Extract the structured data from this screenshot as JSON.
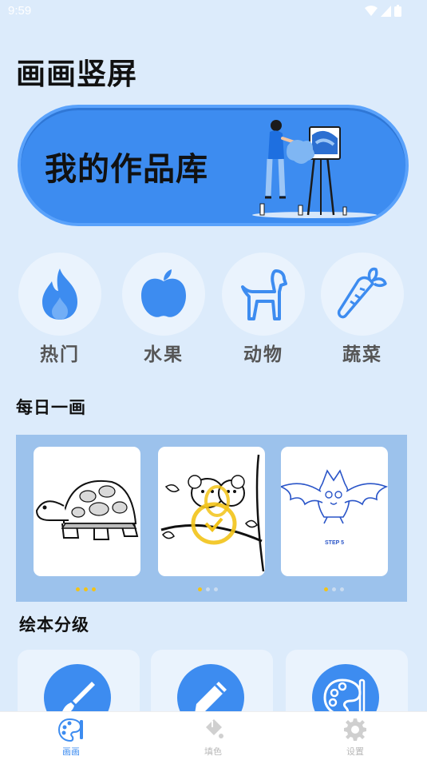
{
  "status": {
    "time": "9:59"
  },
  "app": {
    "title": "画画竖屏"
  },
  "banner": {
    "text": "我的作品库"
  },
  "categories": [
    {
      "label": "热门",
      "icon": "flame-icon"
    },
    {
      "label": "水果",
      "icon": "apple-icon"
    },
    {
      "label": "动物",
      "icon": "dog-icon"
    },
    {
      "label": "蔬菜",
      "icon": "carrot-icon"
    }
  ],
  "daily": {
    "title": "每日一画",
    "cards": [
      {
        "subject": "turtle drawing"
      },
      {
        "subject": "mice on branch drawing"
      },
      {
        "subject": "bat drawing",
        "caption": "STEP 5"
      }
    ]
  },
  "levels": {
    "title": "绘本分级",
    "items": [
      {
        "icon": "brush-icon"
      },
      {
        "icon": "pencil-icon"
      },
      {
        "icon": "palette-icon"
      }
    ]
  },
  "tabs": [
    {
      "label": "画画",
      "icon": "palette-icon",
      "active": true
    },
    {
      "label": "填色",
      "icon": "paint-bucket-icon",
      "active": false
    },
    {
      "label": "设置",
      "icon": "gear-icon",
      "active": false
    }
  ],
  "colors": {
    "accent": "#3d8cf0",
    "background": "#dcebfb",
    "highlight": "#f2c318"
  }
}
